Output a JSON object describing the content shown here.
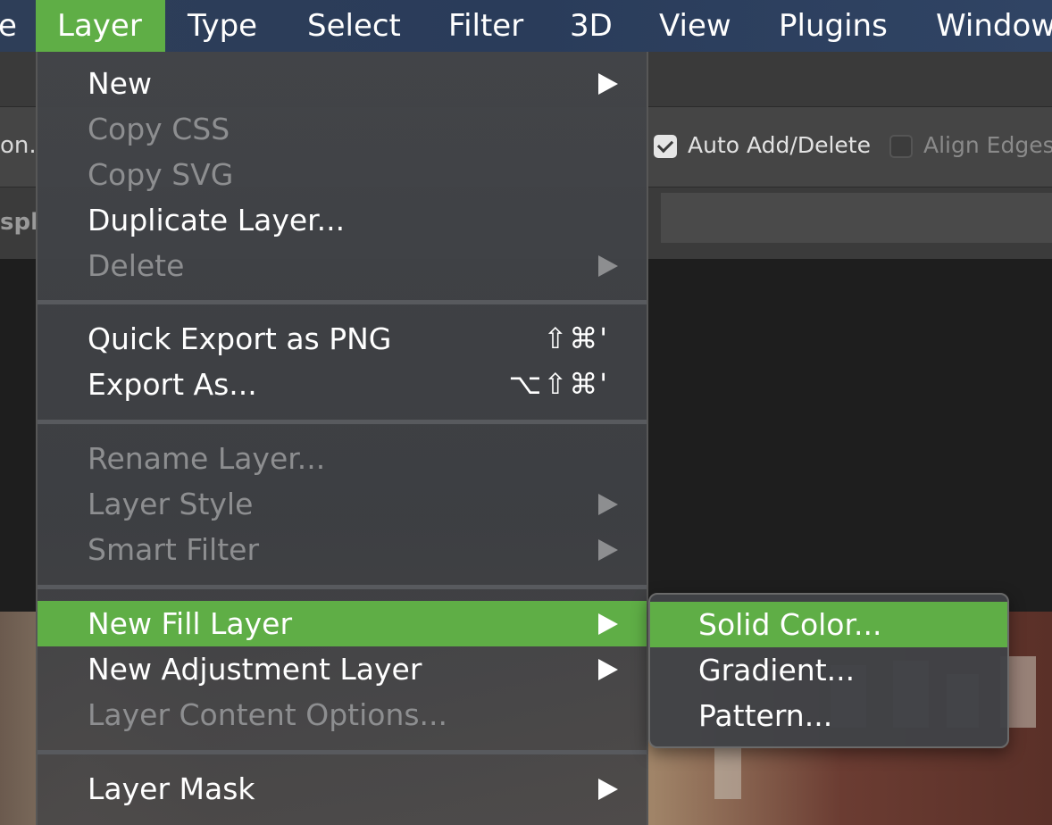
{
  "menubar": {
    "items": [
      {
        "label": "e",
        "active": false
      },
      {
        "label": "Layer",
        "active": true
      },
      {
        "label": "Type",
        "active": false
      },
      {
        "label": "Select",
        "active": false
      },
      {
        "label": "Filter",
        "active": false
      },
      {
        "label": "3D",
        "active": false
      },
      {
        "label": "View",
        "active": false
      },
      {
        "label": "Plugins",
        "active": false
      },
      {
        "label": "Window",
        "active": false
      }
    ]
  },
  "options_bar": {
    "left_fragment": "on.",
    "auto_add_delete": {
      "label": "Auto Add/Delete",
      "checked": true
    },
    "align_edges": {
      "label": "Align Edges",
      "checked": false
    }
  },
  "tab_fragment": "spl",
  "layer_menu": {
    "groups": [
      [
        {
          "label": "New",
          "enabled": true,
          "submenu": true
        },
        {
          "label": "Copy CSS",
          "enabled": false
        },
        {
          "label": "Copy SVG",
          "enabled": false
        },
        {
          "label": "Duplicate Layer...",
          "enabled": true
        },
        {
          "label": "Delete",
          "enabled": false,
          "submenu": true
        }
      ],
      [
        {
          "label": "Quick Export as PNG",
          "enabled": true,
          "shortcut": "⇧⌘'"
        },
        {
          "label": "Export As...",
          "enabled": true,
          "shortcut": "⌥⇧⌘'"
        }
      ],
      [
        {
          "label": "Rename Layer...",
          "enabled": false
        },
        {
          "label": "Layer Style",
          "enabled": false,
          "submenu": true
        },
        {
          "label": "Smart Filter",
          "enabled": false,
          "submenu": true
        }
      ],
      [
        {
          "label": "New Fill Layer",
          "enabled": true,
          "submenu": true,
          "highlighted": true
        },
        {
          "label": "New Adjustment Layer",
          "enabled": true,
          "submenu": true
        },
        {
          "label": "Layer Content Options...",
          "enabled": false
        }
      ],
      [
        {
          "label": "Layer Mask",
          "enabled": true,
          "submenu": true
        }
      ]
    ]
  },
  "fill_submenu": {
    "items": [
      {
        "label": "Solid Color...",
        "highlighted": true
      },
      {
        "label": "Gradient...",
        "highlighted": false
      },
      {
        "label": "Pattern...",
        "highlighted": false
      }
    ]
  },
  "colors": {
    "highlight": "#5fae46",
    "menubar": "#2c3e5a",
    "menu_bg": "#414347",
    "disabled_text": "#8d8e90"
  }
}
